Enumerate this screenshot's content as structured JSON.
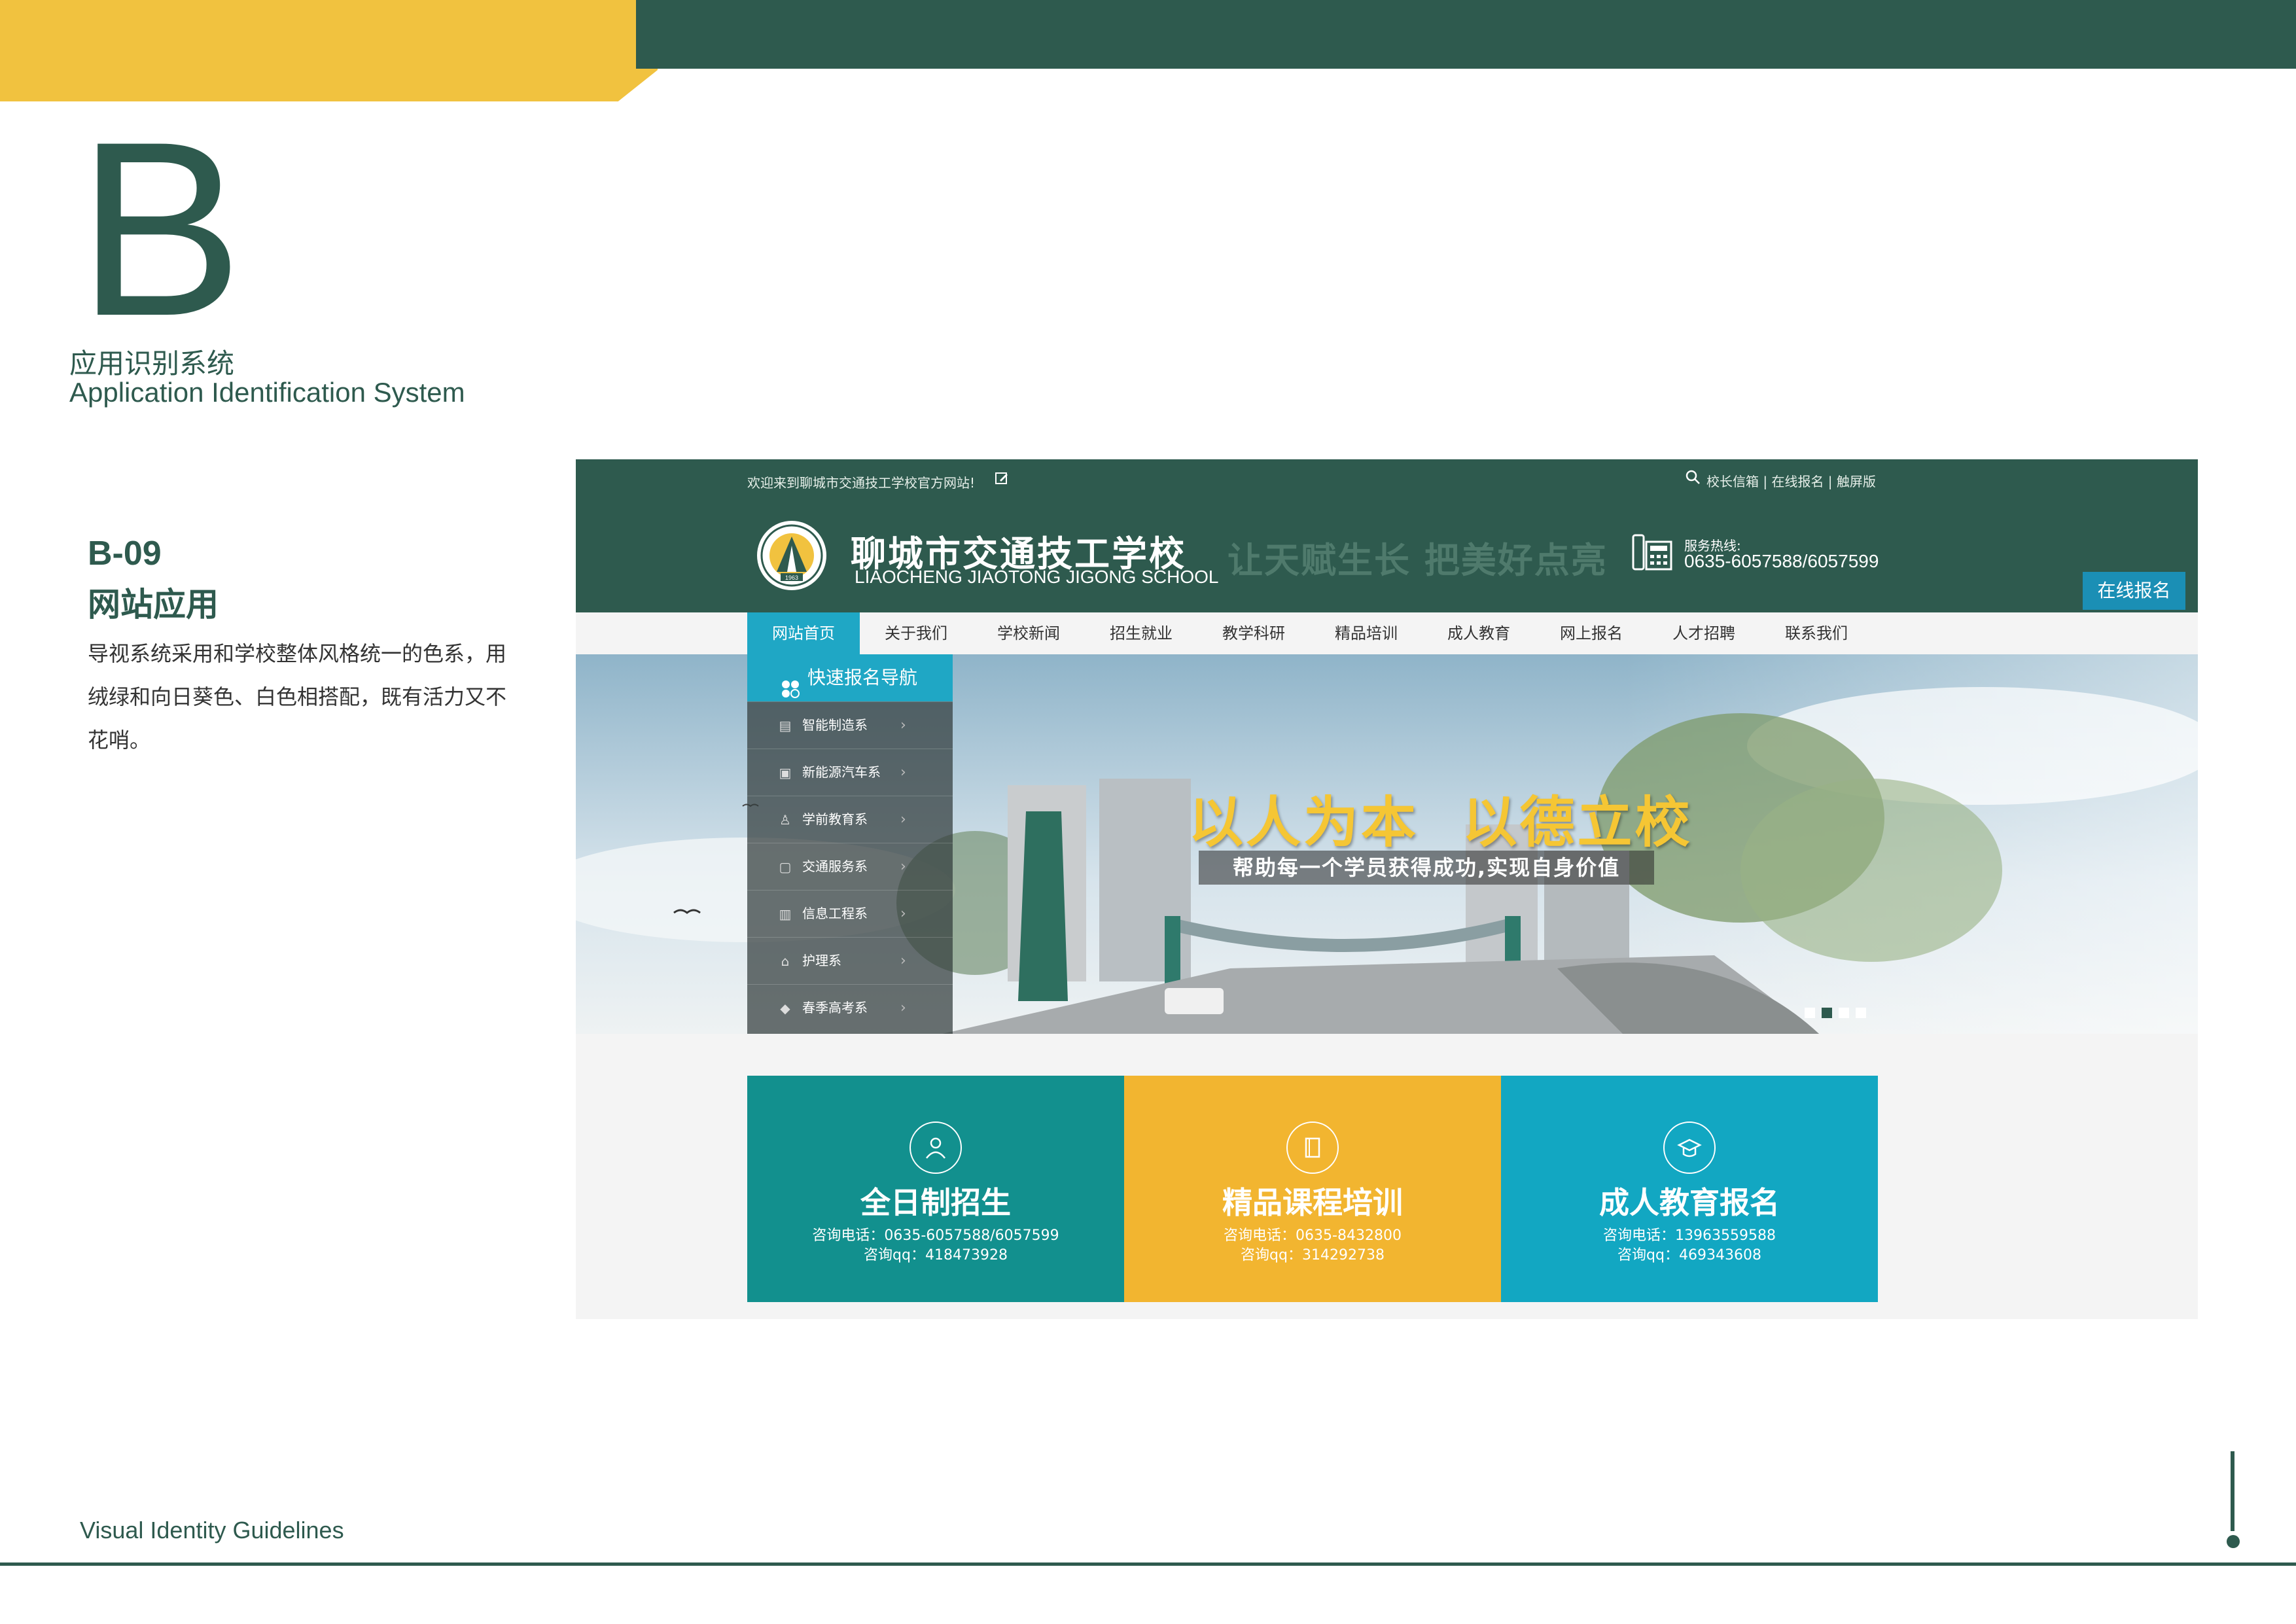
{
  "page": {
    "letter": "B",
    "system_cn": "应用识别系统",
    "system_en": "Application Identification System",
    "section_code": "B-09",
    "section_title": "网站应用",
    "description": "导视系统采用和学校整体风格统一的色系，用绒绿和向日葵色、白色相搭配，既有活力又不花哨。",
    "footer": "Visual Identity Guidelines",
    "colors": {
      "green": "#2e5a4e",
      "yellow": "#f1c23f",
      "teal": "#12908e",
      "sunflower": "#f2b530",
      "cyan": "#12a7c2"
    }
  },
  "site": {
    "welcome": "欢迎来到聊城市交通技工学校官方网站!",
    "top_links": "校长信箱 | 在线报名 | 触屏版",
    "school_cn": "聊城市交通技工学校",
    "school_en": "LIAOCHENG JIAOTONG JIGONG SCHOOL",
    "slogan": "让天赋生长 把美好点亮",
    "hotline_label": "服务热线:",
    "hotline": "0635-6057588/6057599",
    "online_button": "在线报名",
    "logo_year": "1963",
    "nav": [
      "网站首页",
      "关于我们",
      "学校新闻",
      "招生就业",
      "教学科研",
      "精品培训",
      "成人教育",
      "网上报名",
      "人才招聘",
      "联系我们"
    ],
    "sidebar_title": "快速报名导航",
    "sidebar_items": [
      {
        "label": "智能制造系",
        "icon": "book-icon"
      },
      {
        "label": "新能源汽车系",
        "icon": "car-card-icon"
      },
      {
        "label": "学前教育系",
        "icon": "users-icon"
      },
      {
        "label": "交通服务系",
        "icon": "document-icon"
      },
      {
        "label": "信息工程系",
        "icon": "notebook-icon"
      },
      {
        "label": "护理系",
        "icon": "home-icon"
      },
      {
        "label": "春季高考系",
        "icon": "graduation-cap-icon"
      }
    ],
    "banner_title": "以人为本  以德立校",
    "banner_subtitle": "帮助每一个学员获得成功,实现自身价值",
    "cards": [
      {
        "title": "全日制招生",
        "line1": "咨询电话：0635-6057588/6057599",
        "line2": "咨询qq：418473928",
        "icon": "person-icon"
      },
      {
        "title": "精品课程培训",
        "line1": "咨询电话：0635-8432800",
        "line2": "咨询qq：314292738",
        "icon": "book-icon"
      },
      {
        "title": "成人教育报名",
        "line1": "咨询电话：13963559588",
        "line2": "咨询qq：469343608",
        "icon": "graduation-cap-icon"
      }
    ]
  }
}
